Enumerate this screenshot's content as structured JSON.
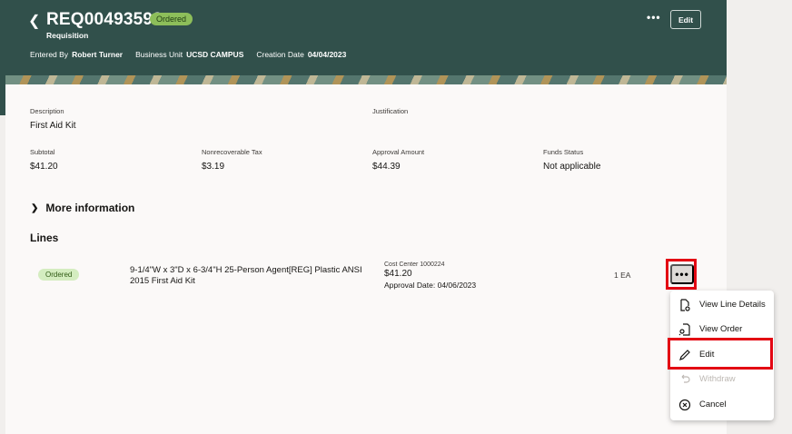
{
  "header": {
    "back_icon": "chevron-left-icon",
    "title": "REQ00493599",
    "status": "Ordered",
    "subtitle": "Requisition",
    "entered_by_label": "Entered By",
    "entered_by": "Robert Turner",
    "business_unit_label": "Business Unit",
    "business_unit": "UCSD CAMPUS",
    "creation_date_label": "Creation Date",
    "creation_date": "04/04/2023",
    "more_label": "•••",
    "edit_label": "Edit"
  },
  "summary": {
    "description_label": "Description",
    "description": "First Aid Kit",
    "justification_label": "Justification",
    "subtotal_label": "Subtotal",
    "subtotal": "$41.20",
    "tax_label": "Nonrecoverable Tax",
    "tax": "$3.19",
    "approval_label": "Approval Amount",
    "approval": "$44.39",
    "funds_label": "Funds Status",
    "funds": "Not applicable"
  },
  "more_info": "More information",
  "lines": {
    "heading": "Lines",
    "items": [
      {
        "status": "Ordered",
        "description": "9-1/4\"W x 3\"D x 6-3/4\"H 25-Person Agent[REG] Plastic ANSI 2015 First Aid Kit",
        "cost_center": "Cost Center 1000224",
        "amount": "$41.20",
        "approval_date": "Approval Date: 04/06/2023",
        "quantity": "1 EA",
        "more_label": "•••"
      }
    ]
  },
  "menu": {
    "items": [
      {
        "label": "View Line Details",
        "icon": "view-details-icon",
        "enabled": true
      },
      {
        "label": "View Order",
        "icon": "view-order-icon",
        "enabled": true
      },
      {
        "label": "Edit",
        "icon": "pencil-icon",
        "enabled": true
      },
      {
        "label": "Withdraw",
        "icon": "undo-icon",
        "enabled": false
      },
      {
        "label": "Cancel",
        "icon": "cancel-circle-icon",
        "enabled": true
      }
    ]
  },
  "colors": {
    "header_bg": "#31504b",
    "highlight": "#e30613",
    "status_green": "#8dbe5a"
  }
}
